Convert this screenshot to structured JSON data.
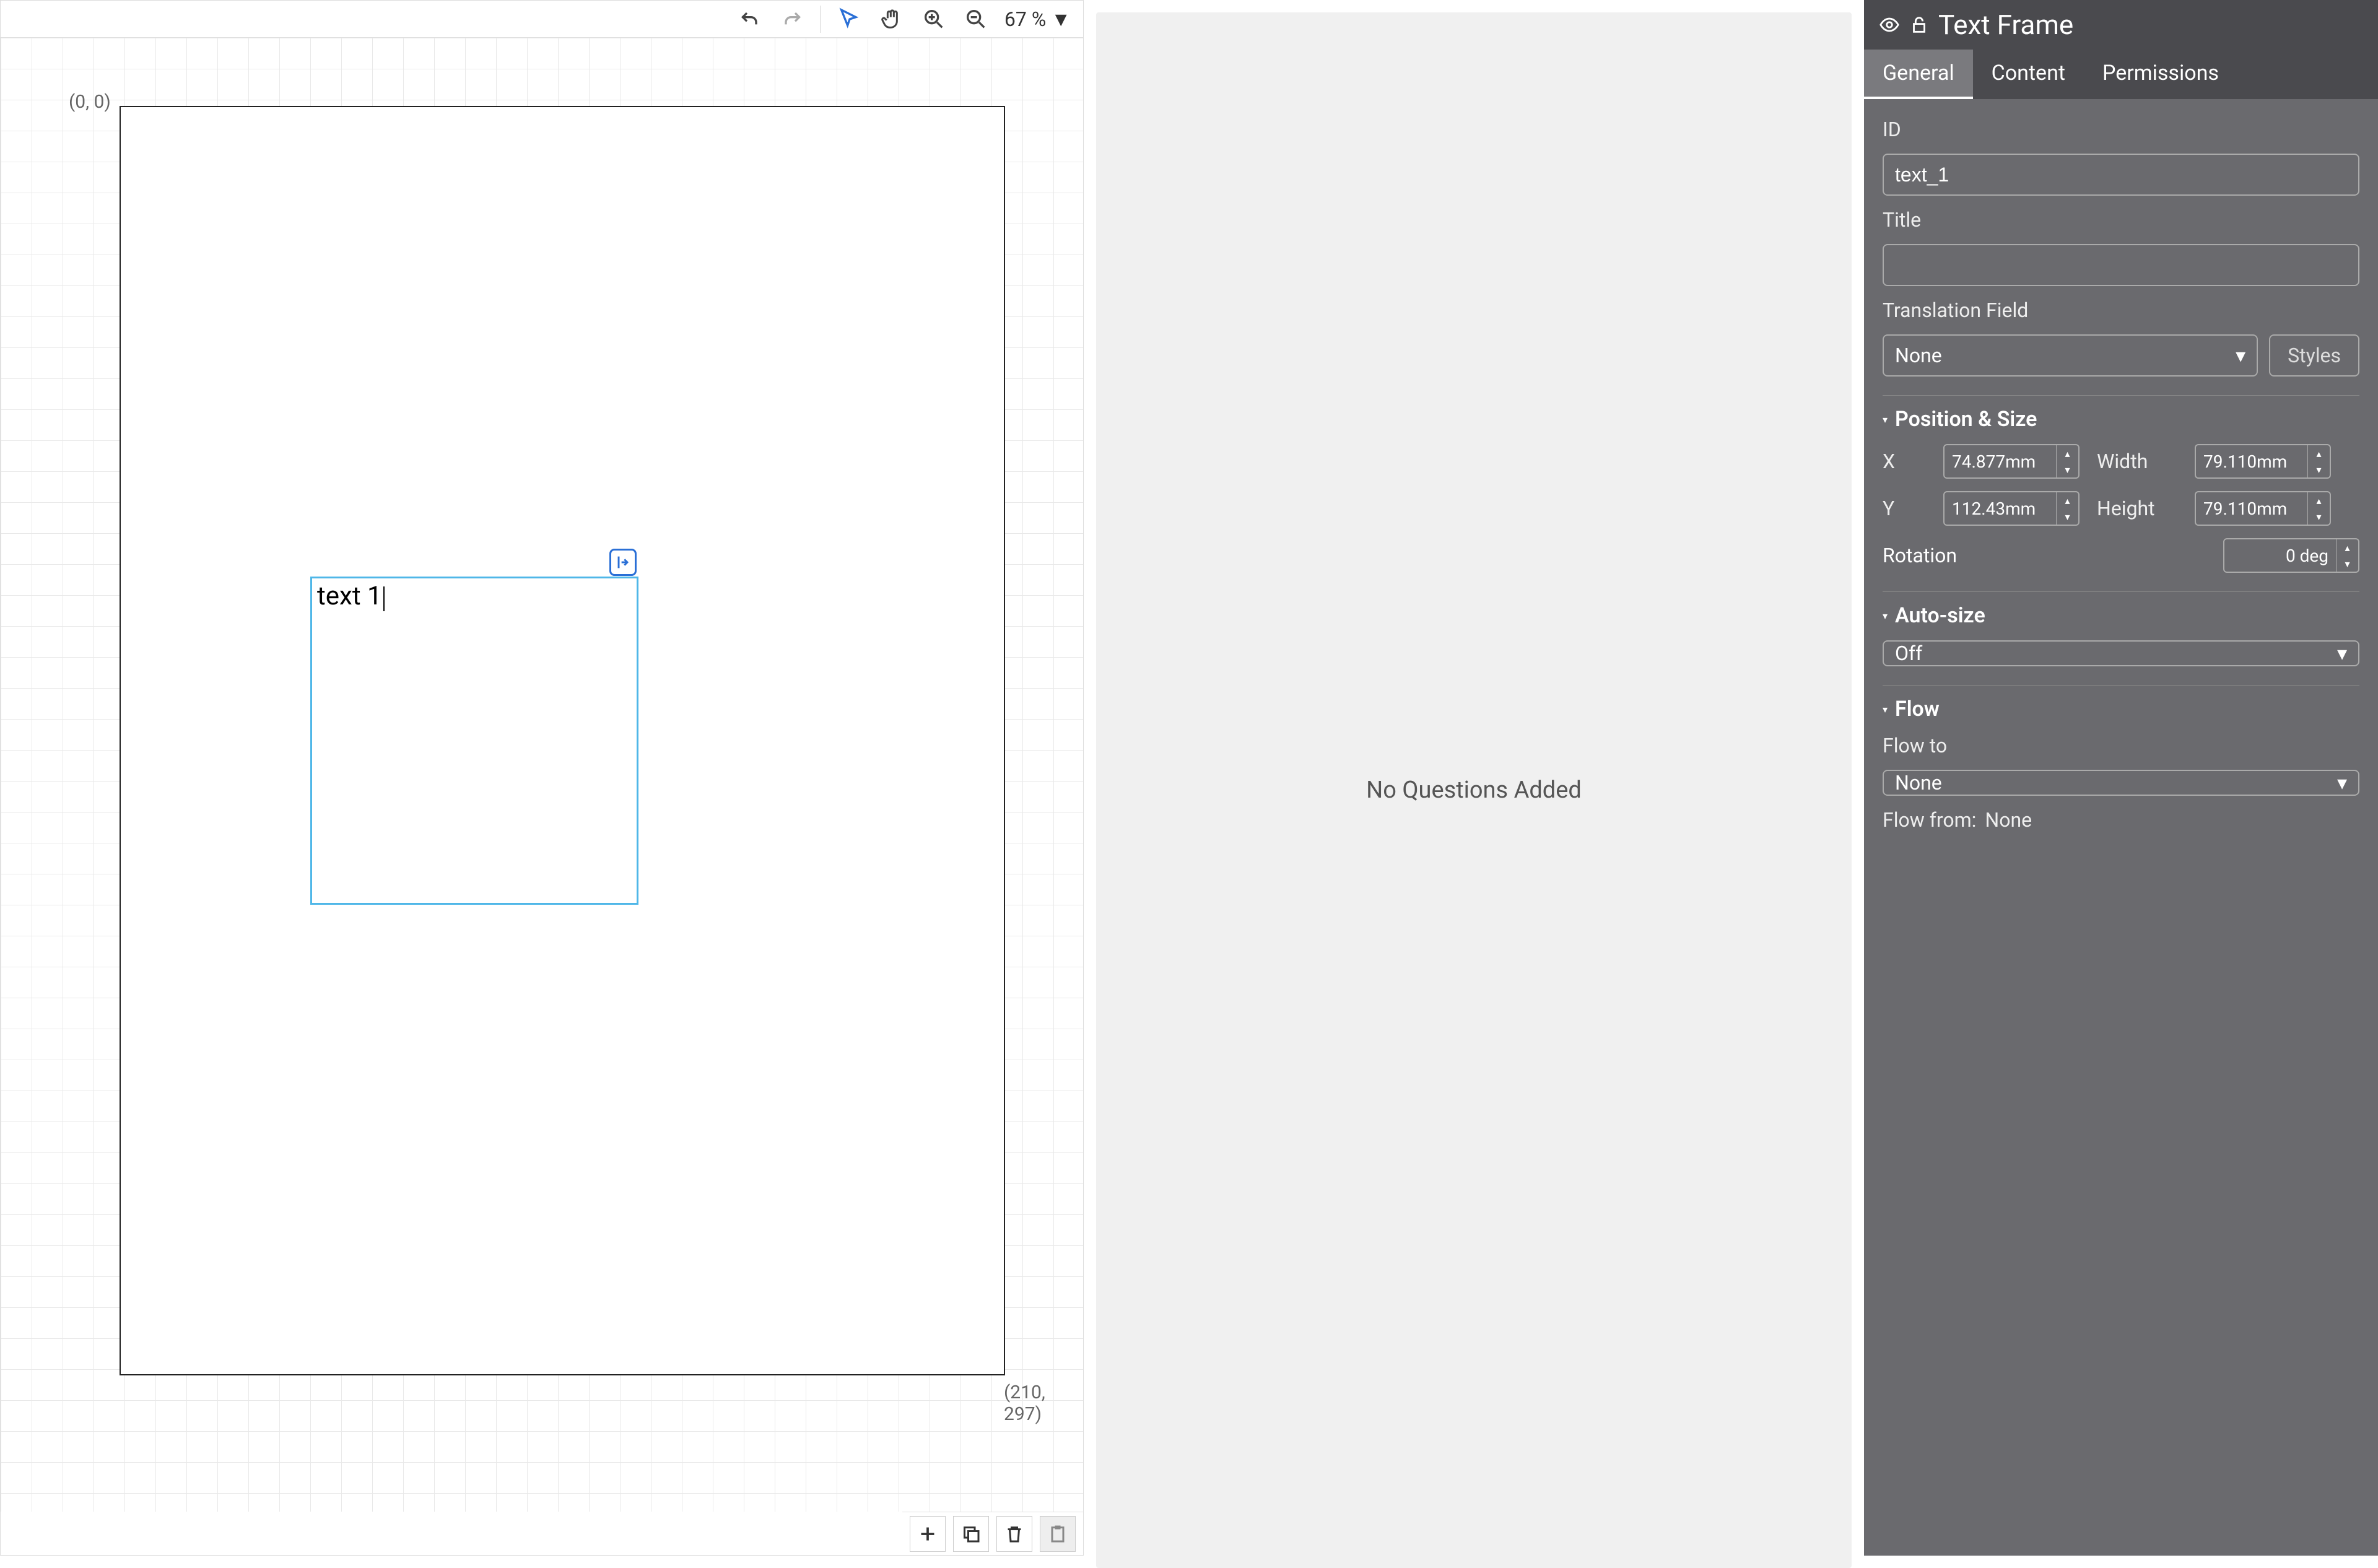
{
  "toolbar": {
    "zoom": "67",
    "zoom_unit": "%"
  },
  "canvas": {
    "origin_label": "(0, 0)",
    "extent_label": "(210, 297)",
    "text_frame_content": "text 1"
  },
  "middle": {
    "no_questions": "No Questions Added"
  },
  "panel": {
    "title": "Text Frame",
    "tabs": {
      "general": "General",
      "content": "Content",
      "permissions": "Permissions"
    },
    "fields": {
      "id_label": "ID",
      "id_value": "text_1",
      "title_label": "Title",
      "title_value": "",
      "translation_label": "Translation Field",
      "translation_value": "None",
      "styles_btn": "Styles"
    },
    "section_position": {
      "title": "Position & Size",
      "x_label": "X",
      "x_value": "74.877mm",
      "y_label": "Y",
      "y_value": "112.43mm",
      "width_label": "Width",
      "width_value": "79.110mm",
      "height_label": "Height",
      "height_value": "79.110mm",
      "rotation_label": "Rotation",
      "rotation_value": "0 deg"
    },
    "section_autosize": {
      "title": "Auto-size",
      "value": "Off"
    },
    "section_flow": {
      "title": "Flow",
      "flow_to_label": "Flow to",
      "flow_to_value": "None",
      "flow_from_label": "Flow from:",
      "flow_from_value": "None"
    }
  }
}
